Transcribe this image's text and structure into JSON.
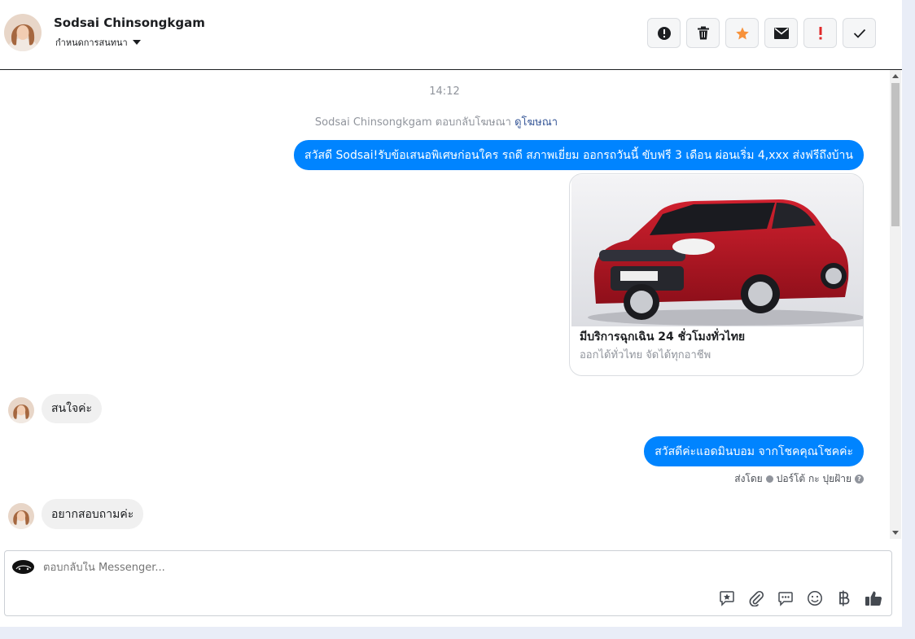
{
  "header": {
    "contact_name": "Sodsai Chinsongkgam",
    "assign_label": "กำหนดการสนทนา",
    "toolbar": [
      {
        "name": "spam-button",
        "icon": "alert-circle-icon"
      },
      {
        "name": "delete-button",
        "icon": "trash-icon"
      },
      {
        "name": "star-button",
        "icon": "star-icon"
      },
      {
        "name": "mark-unread-button",
        "icon": "envelope-icon"
      },
      {
        "name": "follow-up-button",
        "icon": "exclamation-icon"
      },
      {
        "name": "mark-done-button",
        "icon": "checkmark-icon"
      }
    ]
  },
  "thread": {
    "timestamp": "14:12",
    "ad_reply_text": "Sodsai Chinsongkgam ตอบกลับโฆษณา",
    "ad_reply_link": "ดูโฆษณา",
    "messages": [
      {
        "sender": "page",
        "text": "สวัสดี Sodsai!รับข้อเสนอพิเศษก่อนใคร รถดี สภาพเยี่ยม ออกรถวันนี้ ขับฟรี 3 เดือน ผ่อนเริ่ม 4,xxx ส่งฟรีถึงบ้าน"
      },
      {
        "sender": "customer",
        "text": "สนใจค่ะ"
      },
      {
        "sender": "page",
        "text": "สวัสดีค่ะแอดมินบอม จากโชคคุณโชคค่ะ"
      },
      {
        "sender": "customer",
        "text": "อยากสอบถามค่ะ"
      }
    ],
    "ad_card": {
      "title": "มีบริการฉุกเฉิน 24 ชั่วโมงทั่วไทย",
      "subtitle": "ออกได้ทั่วไทย จัดได้ทุกอาชีพ"
    },
    "sent_by_label": "ส่งโดย",
    "sent_by_name": "ปอร์โต้ กะ ปุยฝ้าย"
  },
  "composer": {
    "placeholder": "ตอบกลับใน Messenger...",
    "icons": [
      "saved-reply-icon",
      "attachment-icon",
      "chat-bubble-icon",
      "emoji-icon",
      "baht-payment-icon",
      "thumbs-up-icon"
    ]
  },
  "colors": {
    "accent": "#0084ff",
    "star": "#f7923b",
    "follow_up": "#e02828",
    "link": "#385898"
  }
}
